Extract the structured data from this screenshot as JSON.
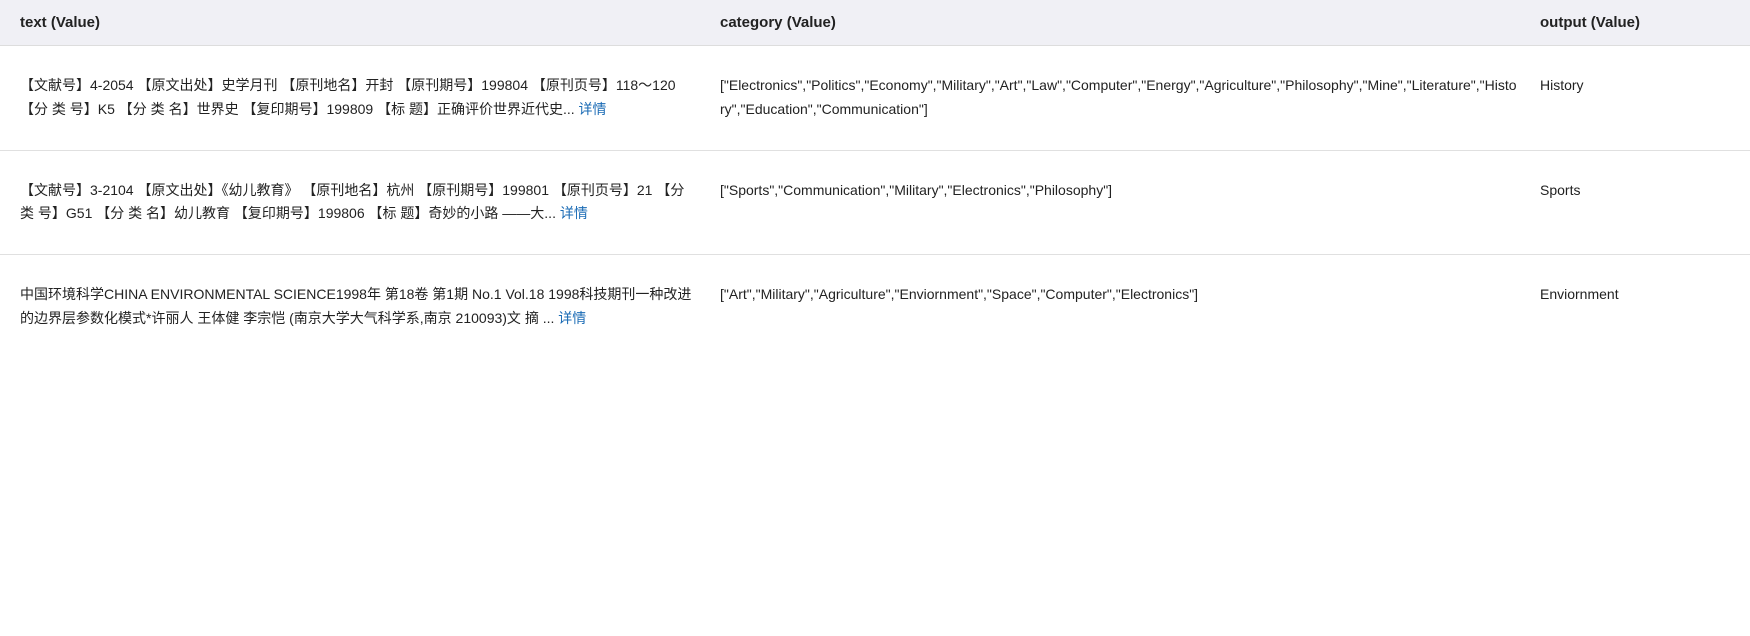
{
  "header": {
    "col_text": "text (Value)",
    "col_category": "category (Value)",
    "col_output": "output (Value)"
  },
  "rows": [
    {
      "id": "row-1",
      "text_main": "【文献号】4-2054 【原文出处】史学月刊 【原刊地名】开封 【原刊期号】199804 【原刊页号】118～120 【分 类 号】K5 【分 类 名】世界史 【复印期号】199809 【标 题】正确评价世界近代史...",
      "text_link": "详情",
      "category": "[\"Electronics\",\"Politics\",\"Economy\",\"Military\",\"Art\",\"Law\",\"Computer\",\"Energy\",\"Agriculture\",\"Philosophy\",\"Mine\",\"Literature\",\"History\",\"Education\",\"Communication\"]",
      "output": "History"
    },
    {
      "id": "row-2",
      "text_main": "【文献号】3-2104 【原文出处】《幼儿教育》 【原刊地名】杭州 【原刊期号】199801 【原刊页号】21 【分 类 号】G51 【分 类 名】幼儿教育 【复印期号】199806 【标 题】奇妙的小路 ——大...",
      "text_link": "详情",
      "category": "[\"Sports\",\"Communication\",\"Military\",\"Electronics\",\"Philosophy\"]",
      "output": "Sports"
    },
    {
      "id": "row-3",
      "text_main": "中国环境科学CHINA ENVIRONMENTAL SCIENCE1998年 第18卷 第1期 No.1 Vol.18 1998科技期刊一种改进的边界层参数化模式*许丽人 王体健  李宗恺  (南京大学大气科学系,南京 210093)文  摘  ...",
      "text_link": "详情",
      "category": "[\"Art\",\"Military\",\"Agriculture\",\"Enviornment\",\"Space\",\"Computer\",\"Electronics\"]",
      "output": "Enviornment"
    }
  ]
}
